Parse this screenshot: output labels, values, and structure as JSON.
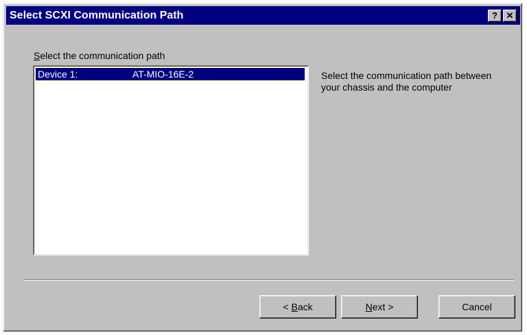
{
  "window": {
    "title": "Select SCXI Communication Path",
    "help_label": "?",
    "close_label": "✕"
  },
  "list": {
    "label_mnemonic": "S",
    "label_rest": "elect the communication path",
    "items": [
      {
        "device": "Device 1:",
        "model": "AT-MIO-16E-2",
        "selected": true
      }
    ]
  },
  "description": "Select the communication path between your chassis and the computer",
  "buttons": {
    "back_prefix": "< ",
    "back_mnemonic": "B",
    "back_rest": "ack",
    "next_mnemonic": "N",
    "next_rest": "ext >",
    "cancel": "Cancel"
  },
  "colors": {
    "title_bar": "#000080",
    "face": "#c0c0c0",
    "selection": "#000080"
  }
}
